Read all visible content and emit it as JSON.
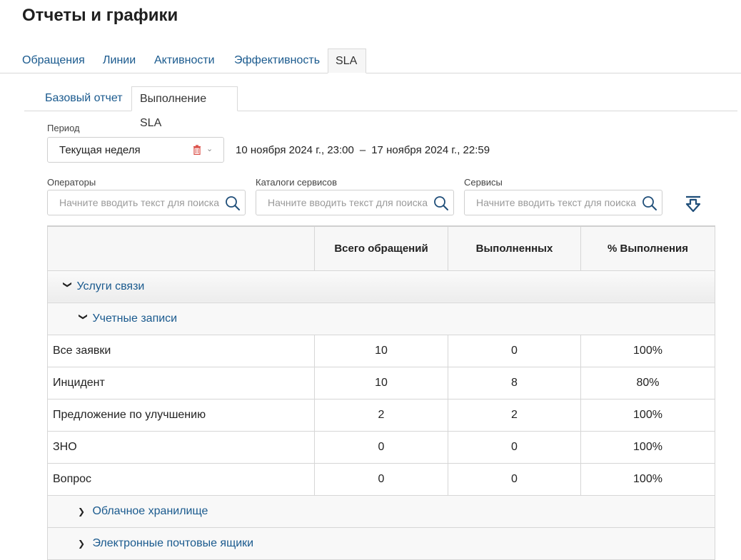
{
  "page": {
    "title": "Отчеты и графики"
  },
  "main_tabs": [
    {
      "label": "Обращения"
    },
    {
      "label": "Линии"
    },
    {
      "label": "Активности"
    },
    {
      "label": "Эффективность"
    },
    {
      "label": "SLA"
    }
  ],
  "sub_tabs": [
    {
      "label": "Базовый отчет"
    },
    {
      "label": "Выполнение SLA"
    }
  ],
  "filters": {
    "period_label": "Период",
    "period_value": "Текущая неделя",
    "period_start": "10 ноября 2024 г., 23:00",
    "period_sep": "–",
    "period_end": "17 ноября 2024 г., 22:59",
    "operators_label": "Операторы",
    "catalogs_label": "Каталоги сервисов",
    "services_label": "Сервисы",
    "search_placeholder": "Начните вводить текст для поиска"
  },
  "table": {
    "headers": [
      "",
      "Всего обращений",
      "Выполненных",
      "% Выполнения"
    ],
    "group1": "Услуги связи",
    "group1_sub": "Учетные записи",
    "rows": [
      {
        "name": "Все заявки",
        "total": "10",
        "done": "0",
        "pct": "100%"
      },
      {
        "name": "Инцидент",
        "total": "10",
        "done": "8",
        "pct": "80%"
      },
      {
        "name": "Предложение по улучшению",
        "total": "2",
        "done": "2",
        "pct": "100%"
      },
      {
        "name": "ЗНО",
        "total": "0",
        "done": "0",
        "pct": "100%"
      },
      {
        "name": "Вопрос",
        "total": "0",
        "done": "0",
        "pct": "100%"
      }
    ],
    "collapsed_groups": [
      "Облачное хранилище",
      "Электронные почтовые ящики"
    ]
  },
  "colors": {
    "link": "#1a5a8e",
    "trash": "#d9473f",
    "accent": "#1f4e79"
  },
  "icons": [
    "trash-icon",
    "chevron-down-icon",
    "search-icon",
    "export-icon",
    "chevron-right-icon"
  ]
}
